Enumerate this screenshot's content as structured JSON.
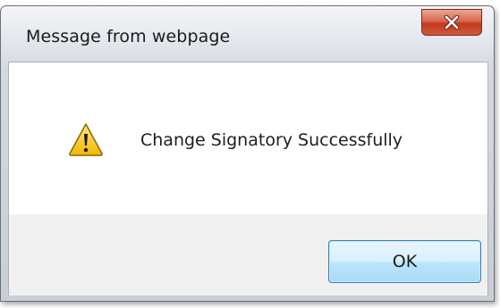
{
  "dialog": {
    "title": "Message from webpage",
    "message": "Change Signatory Successfully",
    "icon": "warning-icon",
    "ok_label": "OK",
    "close_icon": "close-icon"
  },
  "colors": {
    "close_button": "#c3391f",
    "ok_button_border": "#3c7fb1",
    "warning_fill": "#f5c400"
  }
}
